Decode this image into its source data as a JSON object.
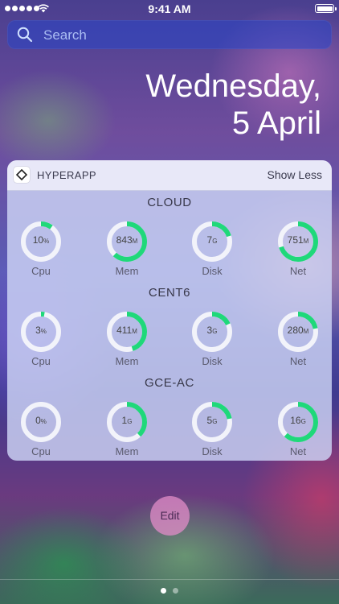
{
  "status_bar": {
    "time": "9:41 AM"
  },
  "search": {
    "placeholder": "Search"
  },
  "date": {
    "line1": "Wednesday,",
    "line2": "5 April"
  },
  "widget": {
    "app_name": "HYPERAPP",
    "toggle_label": "Show Less",
    "accent_color": "#1fd87a",
    "track_color": "#f2f3fa",
    "servers": [
      {
        "name": "CLOUD",
        "metrics": [
          {
            "label": "Cpu",
            "value": "10",
            "unit": "%",
            "fraction": 0.1
          },
          {
            "label": "Mem",
            "value": "843",
            "unit": "M",
            "fraction": 0.62
          },
          {
            "label": "Disk",
            "value": "7",
            "unit": "G",
            "fraction": 0.2
          },
          {
            "label": "Net",
            "value": "751",
            "unit": "M",
            "fraction": 0.7
          }
        ]
      },
      {
        "name": "CENT6",
        "metrics": [
          {
            "label": "Cpu",
            "value": "3",
            "unit": "%",
            "fraction": 0.03
          },
          {
            "label": "Mem",
            "value": "411",
            "unit": "M",
            "fraction": 0.45
          },
          {
            "label": "Disk",
            "value": "3",
            "unit": "G",
            "fraction": 0.18
          },
          {
            "label": "Net",
            "value": "280",
            "unit": "M",
            "fraction": 0.22
          }
        ]
      },
      {
        "name": "GCE-AC",
        "metrics": [
          {
            "label": "Cpu",
            "value": "0",
            "unit": "%",
            "fraction": 0.0
          },
          {
            "label": "Mem",
            "value": "1",
            "unit": "G",
            "fraction": 0.38
          },
          {
            "label": "Disk",
            "value": "5",
            "unit": "G",
            "fraction": 0.22
          },
          {
            "label": "Net",
            "value": "16",
            "unit": "G",
            "fraction": 0.62
          }
        ]
      }
    ]
  },
  "edit_button": {
    "label": "Edit"
  },
  "page_indicator": {
    "count": 2,
    "current": 1
  }
}
